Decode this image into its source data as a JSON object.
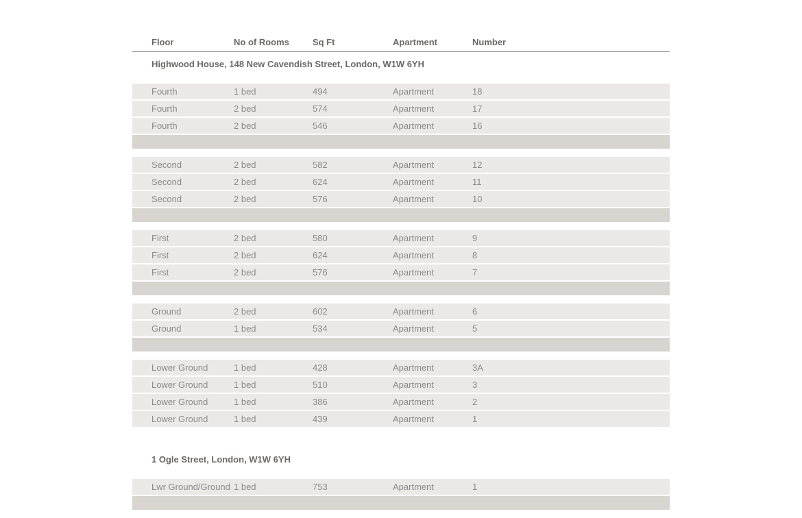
{
  "columns": {
    "floor": "Floor",
    "rooms": "No of Rooms",
    "sqft": "Sq Ft",
    "type": "Apartment",
    "number": "Number"
  },
  "sections": [
    {
      "title": "Highwood House, 148 New Cavendish Street, London, W1W 6YH",
      "groups": [
        {
          "rows": [
            {
              "floor": "Fourth",
              "rooms": "1 bed",
              "sqft": "494",
              "type": "Apartment",
              "number": "18"
            },
            {
              "floor": "Fourth",
              "rooms": "2 bed",
              "sqft": "574",
              "type": "Apartment",
              "number": "17"
            },
            {
              "floor": "Fourth",
              "rooms": "2 bed",
              "sqft": "546",
              "type": "Apartment",
              "number": "16"
            }
          ]
        },
        {
          "rows": [
            {
              "floor": "Second",
              "rooms": "2 bed",
              "sqft": "582",
              "type": "Apartment",
              "number": "12"
            },
            {
              "floor": "Second",
              "rooms": "2 bed",
              "sqft": "624",
              "type": "Apartment",
              "number": "11"
            },
            {
              "floor": "Second",
              "rooms": "2 bed",
              "sqft": "576",
              "type": "Apartment",
              "number": "10"
            }
          ]
        },
        {
          "rows": [
            {
              "floor": "First",
              "rooms": "2 bed",
              "sqft": "580",
              "type": "Apartment",
              "number": "9"
            },
            {
              "floor": "First",
              "rooms": "2 bed",
              "sqft": "624",
              "type": "Apartment",
              "number": "8"
            },
            {
              "floor": "First",
              "rooms": "2 bed",
              "sqft": "576",
              "type": "Apartment",
              "number": "7"
            }
          ]
        },
        {
          "rows": [
            {
              "floor": "Ground",
              "rooms": "2 bed",
              "sqft": "602",
              "type": "Apartment",
              "number": "6"
            },
            {
              "floor": "Ground",
              "rooms": "1 bed",
              "sqft": "534",
              "type": "Apartment",
              "number": "5"
            }
          ]
        },
        {
          "rows": [
            {
              "floor": "Lower Ground",
              "rooms": "1 bed",
              "sqft": "428",
              "type": "Apartment",
              "number": "3A"
            },
            {
              "floor": "Lower Ground",
              "rooms": "1 bed",
              "sqft": "510",
              "type": "Apartment",
              "number": "3"
            },
            {
              "floor": "Lower Ground",
              "rooms": "1 bed",
              "sqft": "386",
              "type": "Apartment",
              "number": "2"
            },
            {
              "floor": "Lower Ground",
              "rooms": "1 bed",
              "sqft": "439",
              "type": "Apartment",
              "number": "1"
            }
          ],
          "no_spacer_after": true
        }
      ]
    },
    {
      "title": "1 Ogle Street, London, W1W 6YH",
      "groups": [
        {
          "rows": [
            {
              "floor": "Lwr Ground/Ground",
              "rooms": "1 bed",
              "sqft": "753",
              "type": "Apartment",
              "number": "1"
            }
          ]
        }
      ]
    }
  ]
}
